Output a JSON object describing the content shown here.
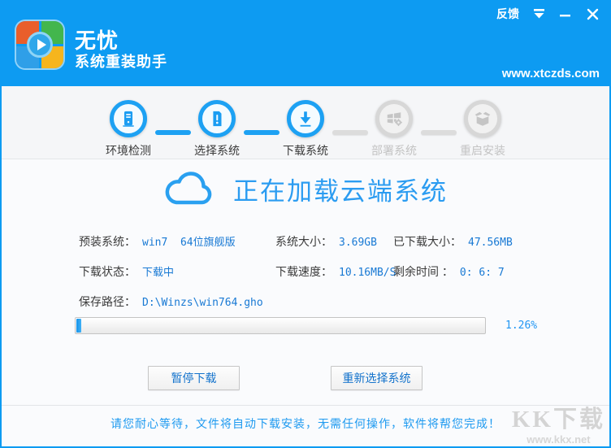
{
  "colors": {
    "brand_blue": "#0d9bf2",
    "accent_blue": "#1da1f3",
    "value_blue": "#1879d4",
    "notice_blue": "#1e9af0",
    "inactive_gray": "#d7d7d7"
  },
  "titlebar": {
    "app_name": "无忧",
    "app_subtitle": "系统重装助手",
    "feedback": "反馈",
    "website": "www.xtczds.com"
  },
  "steps": [
    {
      "label": "环境检测",
      "state": "done"
    },
    {
      "label": "选择系统",
      "state": "done"
    },
    {
      "label": "下载系统",
      "state": "active"
    },
    {
      "label": "部署系统",
      "state": "pending"
    },
    {
      "label": "重启安装",
      "state": "pending"
    }
  ],
  "connectors": [
    {
      "state": "done"
    },
    {
      "state": "done"
    },
    {
      "state": "pending"
    },
    {
      "state": "pending"
    }
  ],
  "status": {
    "title": "正在加载云端系统"
  },
  "info": {
    "preinstalled_label": "预装系统：",
    "preinstalled_value": "win7  64位旗舰版",
    "size_label": "系统大小：",
    "size_value": "3.69GB",
    "downloaded_label": "已下载大小：",
    "downloaded_value": "47.56MB",
    "state_label": "下载状态：",
    "state_value": "下载中",
    "speed_label": "下载速度：",
    "speed_value": "10.16MB/S",
    "remaining_label": "剩余时间 ：",
    "remaining_value": "0: 6: 7",
    "path_label": "保存路径：",
    "path_value": "D:\\Winzs\\win764.gho"
  },
  "progress": {
    "percent": 1.26,
    "percent_text": "1.26%"
  },
  "buttons": {
    "pause": "暂停下载",
    "reselect": "重新选择系统"
  },
  "footer": {
    "notice": "请您耐心等待，文件将自动下载安装，无需任何操作，软件将帮您完成！"
  },
  "watermark": {
    "name": "KK下载",
    "url": "www.kkx.net"
  }
}
